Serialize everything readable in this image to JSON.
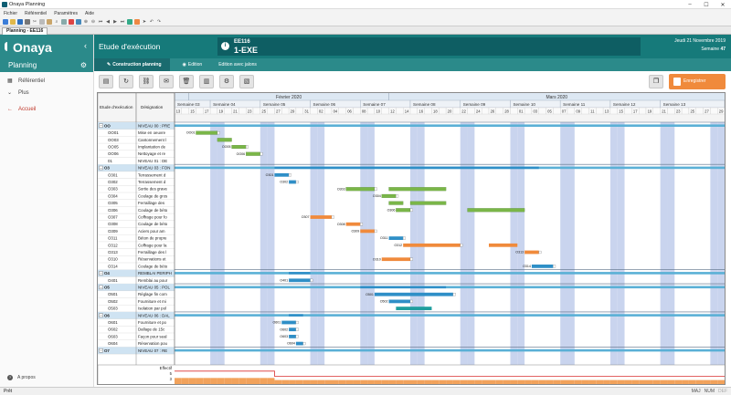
{
  "window": {
    "title": "Onaya Planning"
  },
  "menu": [
    "Fichier",
    "Référentiel",
    "Paramètres",
    "Aide"
  ],
  "doc_tab": "Planning - EE116",
  "sidebar": {
    "brand": "Onaya",
    "section": "Planning",
    "items": [
      {
        "label": "Référentiel",
        "icon": "grid-icon"
      },
      {
        "label": "Plus",
        "icon": "chevron-down-icon"
      },
      {
        "label": "Accueil",
        "icon": "arrow-left-icon"
      }
    ],
    "footer": "A propos"
  },
  "header": {
    "title": "Etude d'exécution",
    "code": "EE116",
    "code_big": "1-EXE",
    "date": "Jeudi 21 Novembre 2019",
    "week_label": "Semaine",
    "week": "47"
  },
  "subtabs": [
    "Construction planning",
    "Edition",
    "Edition avec jalons"
  ],
  "actions": {
    "save": "Enregistrer"
  },
  "gantt": {
    "columns": [
      "Etude d'exécution",
      "Désignation"
    ],
    "months": [
      {
        "label": "Février 2020",
        "start": 2
      },
      {
        "label": "Mars 2020",
        "start": 30
      }
    ],
    "weeks": [
      {
        "label": "Semaine 03",
        "start": 0
      },
      {
        "label": "Semaine 04",
        "start": 5
      },
      {
        "label": "Semaine 05",
        "start": 12
      },
      {
        "label": "Semaine 06",
        "start": 19
      },
      {
        "label": "Semaine 07",
        "start": 26
      },
      {
        "label": "Semaine 08",
        "start": 33
      },
      {
        "label": "Semaine 09",
        "start": 40
      },
      {
        "label": "Semaine 10",
        "start": 47
      },
      {
        "label": "Semaine 11",
        "start": 54
      },
      {
        "label": "Semaine 12",
        "start": 61
      },
      {
        "label": "Semaine 13",
        "start": 68
      }
    ],
    "days": [
      "13",
      "14",
      "15",
      "16",
      "17",
      "18",
      "19",
      "20",
      "21",
      "22",
      "23",
      "24",
      "25",
      "26",
      "27",
      "28",
      "29",
      "30",
      "31",
      "01",
      "02",
      "03",
      "04",
      "05",
      "06",
      "07",
      "08",
      "09",
      "10",
      "11",
      "12",
      "13",
      "14",
      "15",
      "16",
      "17",
      "18",
      "19",
      "20",
      "21",
      "22",
      "23",
      "24",
      "25",
      "26",
      "27",
      "28",
      "29",
      "01",
      "02",
      "03",
      "04",
      "05",
      "06",
      "07",
      "08",
      "09",
      "10",
      "11",
      "12",
      "13",
      "14",
      "15",
      "16",
      "17",
      "18",
      "19",
      "20",
      "21",
      "22",
      "23",
      "24",
      "25",
      "26",
      "27",
      "28",
      "29"
    ],
    "day_labels_shown": [
      "13",
      "15",
      "17",
      "19",
      "21",
      "23",
      "25",
      "27",
      "29",
      "31",
      "02",
      "04",
      "06",
      "08",
      "10",
      "12",
      "14",
      "16",
      "18",
      "20",
      "22",
      "24",
      "26",
      "28",
      "01",
      "03",
      "05",
      "07",
      "09",
      "11",
      "13",
      "15",
      "17",
      "19",
      "21",
      "23",
      "25",
      "27",
      "29"
    ],
    "rows": [
      {
        "code": "OO",
        "label": "NIVEAU 00 : PRE",
        "group": true,
        "bars": [
          {
            "s": 0,
            "e": 79,
            "c": "#5ab0d6",
            "summary": true
          }
        ]
      },
      {
        "code": "OO01",
        "label": "Mise en oeuvre",
        "bars": [
          {
            "s": 3,
            "e": 6,
            "c": "#7ab648",
            "tag": "OO01"
          }
        ]
      },
      {
        "code": "OO03",
        "label": "Cantonnement l",
        "bars": [
          {
            "s": 6,
            "e": 8,
            "c": "#7ab648"
          }
        ]
      },
      {
        "code": "OO05",
        "label": "Implantation de",
        "bars": [
          {
            "s": 8,
            "e": 10,
            "c": "#7ab648",
            "tag": "OO05"
          }
        ]
      },
      {
        "code": "OO06",
        "label": "Nettoyage et re",
        "bars": [
          {
            "s": 10,
            "e": 12,
            "c": "#7ab648",
            "tag": "OO06"
          }
        ]
      },
      {
        "code": "01",
        "label": "NIVEAU 01 : DE",
        "bars": []
      },
      {
        "code": "O3",
        "label": "NIVEAU 03 : FON",
        "group": true,
        "bars": [
          {
            "s": 0,
            "e": 79,
            "c": "#5ab0d6",
            "summary": true
          },
          {
            "s": 14,
            "e": 51,
            "c": "#2f8fc7",
            "summary": true
          }
        ]
      },
      {
        "code": "O301",
        "label": "Terrassement d",
        "bars": [
          {
            "s": 14,
            "e": 16,
            "c": "#2f8fc7",
            "tag": "O301"
          }
        ]
      },
      {
        "code": "O302",
        "label": "Terrassement d",
        "bars": [
          {
            "s": 16,
            "e": 17,
            "c": "#2f8fc7",
            "tag": "O302"
          }
        ]
      },
      {
        "code": "O303",
        "label": "Sortie des grave",
        "bars": [
          {
            "s": 24,
            "e": 28,
            "c": "#7ab648",
            "tag": "O303"
          },
          {
            "s": 30,
            "e": 38,
            "c": "#7ab648"
          }
        ]
      },
      {
        "code": "O304",
        "label": "Coulage de gros",
        "bars": [
          {
            "s": 29,
            "e": 31,
            "c": "#7ab648",
            "tag": "O304"
          }
        ]
      },
      {
        "code": "O305",
        "label": "Ferraillage des",
        "bars": [
          {
            "s": 30,
            "e": 32,
            "c": "#7ab648"
          },
          {
            "s": 33,
            "e": 38,
            "c": "#7ab648"
          }
        ]
      },
      {
        "code": "O306",
        "label": "Coulage de béto",
        "bars": [
          {
            "s": 31,
            "e": 33,
            "c": "#7ab648",
            "tag": "O306"
          },
          {
            "s": 41,
            "e": 49,
            "c": "#7ab648"
          }
        ]
      },
      {
        "code": "O307",
        "label": "Coffrage pour fo",
        "bars": [
          {
            "s": 19,
            "e": 22,
            "c": "#f08a3c",
            "tag": "O307"
          }
        ]
      },
      {
        "code": "O308",
        "label": "Coulage de béto",
        "bars": [
          {
            "s": 24,
            "e": 26,
            "c": "#f08a3c",
            "tag": "O308"
          }
        ]
      },
      {
        "code": "O309",
        "label": "Aciers pour am",
        "bars": [
          {
            "s": 26,
            "e": 28,
            "c": "#f08a3c",
            "tag": "O309"
          }
        ]
      },
      {
        "code": "O311",
        "label": "Béton de propre",
        "bars": [
          {
            "s": 30,
            "e": 32,
            "c": "#2f8fc7",
            "tag": "O311"
          }
        ]
      },
      {
        "code": "O312",
        "label": "Coffrage pour la",
        "bars": [
          {
            "s": 32,
            "e": 40,
            "c": "#f08a3c",
            "tag": "O312"
          },
          {
            "s": 44,
            "e": 48,
            "c": "#f08a3c"
          }
        ]
      },
      {
        "code": "O313",
        "label": "Ferraillage des l",
        "bars": [
          {
            "s": 49,
            "e": 51,
            "c": "#f08a3c",
            "tag": "O313"
          }
        ]
      },
      {
        "code": "O310",
        "label": "Réservations et",
        "bars": [
          {
            "s": 29,
            "e": 33,
            "c": "#f08a3c",
            "tag": "O310"
          }
        ]
      },
      {
        "code": "O314",
        "label": "Coulage de béto",
        "bars": [
          {
            "s": 50,
            "e": 53,
            "c": "#2f8fc7",
            "tag": "O314"
          }
        ]
      },
      {
        "code": "O4",
        "label": "REMBLAI PERIPH",
        "group": true,
        "bars": [
          {
            "s": 0,
            "e": 79,
            "c": "#5ab0d6",
            "summary": true
          },
          {
            "s": 16,
            "e": 19,
            "c": "#2f8fc7",
            "summary": true
          }
        ]
      },
      {
        "code": "O401",
        "label": "Remblai au pour",
        "bars": [
          {
            "s": 16,
            "e": 19,
            "c": "#2f8fc7",
            "tag": "O401"
          }
        ]
      },
      {
        "code": "O5",
        "label": "NIVEAU 05 : POL",
        "group": true,
        "bars": [
          {
            "s": 0,
            "e": 79,
            "c": "#5ab0d6",
            "summary": true
          },
          {
            "s": 26,
            "e": 38,
            "c": "#2f8fc7",
            "summary": true
          }
        ]
      },
      {
        "code": "O501",
        "label": "Réglage fin com",
        "bars": [
          {
            "s": 28,
            "e": 39,
            "c": "#2f8fc7",
            "tag": "O501"
          }
        ]
      },
      {
        "code": "O502",
        "label": "Fourniture et mi",
        "bars": [
          {
            "s": 30,
            "e": 33,
            "c": "#2f8fc7",
            "tag": "O502"
          }
        ]
      },
      {
        "code": "O503",
        "label": "Isolation par pol",
        "bars": [
          {
            "s": 31,
            "e": 36,
            "c": "#1f9e9e"
          }
        ]
      },
      {
        "code": "O6",
        "label": "NIVEAU 06 : DAL",
        "group": true,
        "bars": [
          {
            "s": 0,
            "e": 79,
            "c": "#5ab0d6",
            "summary": true
          },
          {
            "s": 16,
            "e": 18,
            "c": "#2f8fc7",
            "summary": true
          }
        ]
      },
      {
        "code": "O601",
        "label": "Fourniture et po",
        "bars": [
          {
            "s": 15,
            "e": 17,
            "c": "#2f8fc7",
            "tag": "O601"
          }
        ]
      },
      {
        "code": "O602",
        "label": "Dallage de 15c",
        "bars": [
          {
            "s": 16,
            "e": 17,
            "c": "#2f8fc7",
            "tag": "O602"
          }
        ]
      },
      {
        "code": "O603",
        "label": "Façon pour seal",
        "bars": [
          {
            "s": 16,
            "e": 17,
            "c": "#2f8fc7",
            "tag": "O603"
          }
        ]
      },
      {
        "code": "O604",
        "label": "Réservation pou",
        "bars": [
          {
            "s": 17,
            "e": 18,
            "c": "#2f8fc7",
            "tag": "O604"
          }
        ]
      },
      {
        "code": "O7",
        "label": "NIVEAU 07 : RE",
        "group": true,
        "bars": [
          {
            "s": 0,
            "e": 79,
            "c": "#5ab0d6",
            "summary": true
          }
        ]
      }
    ],
    "effectif_label": "Effectif",
    "effectif_axis": [
      "5",
      "3"
    ],
    "effectif": [
      5,
      5,
      5,
      5,
      5,
      5,
      5,
      5,
      5,
      5,
      5,
      5,
      5,
      5,
      3,
      3,
      3,
      3,
      3,
      3,
      3,
      3,
      3,
      3,
      3,
      3,
      3,
      3,
      3,
      3,
      3,
      3,
      3,
      3,
      3,
      3,
      3,
      3,
      3,
      3,
      3,
      3,
      3,
      3,
      3,
      3,
      3,
      3,
      3,
      3,
      3,
      3,
      3,
      3,
      3,
      3,
      3,
      3,
      3,
      3,
      3,
      3,
      3,
      3,
      3,
      3,
      3,
      3,
      3,
      3,
      3,
      3,
      3,
      3,
      3,
      3,
      3,
      3,
      3
    ]
  },
  "footer": {
    "status": "Prêt",
    "keys": [
      "MAJ",
      "NUM",
      "DEF"
    ]
  }
}
